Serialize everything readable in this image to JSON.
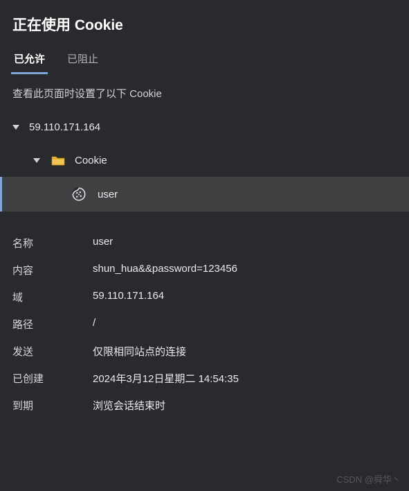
{
  "title": "正在使用 Cookie",
  "tabs": {
    "allowed": "已允许",
    "blocked": "已阻止"
  },
  "description": "查看此页面时设置了以下 Cookie",
  "tree": {
    "domain": "59.110.171.164",
    "folder": "Cookie",
    "cookie": "user"
  },
  "details": {
    "name_label": "名称",
    "name_value": "user",
    "content_label": "内容",
    "content_value": "shun_hua&&password=123456",
    "domain_label": "域",
    "domain_value": "59.110.171.164",
    "path_label": "路径",
    "path_value": "/",
    "send_label": "发送",
    "send_value": "仅限相同站点的连接",
    "created_label": "已创建",
    "created_value": "2024年3月12日星期二 14:54:35",
    "expires_label": "到期",
    "expires_value": "浏览会话结束时"
  },
  "watermark": "CSDN @舜华丶"
}
